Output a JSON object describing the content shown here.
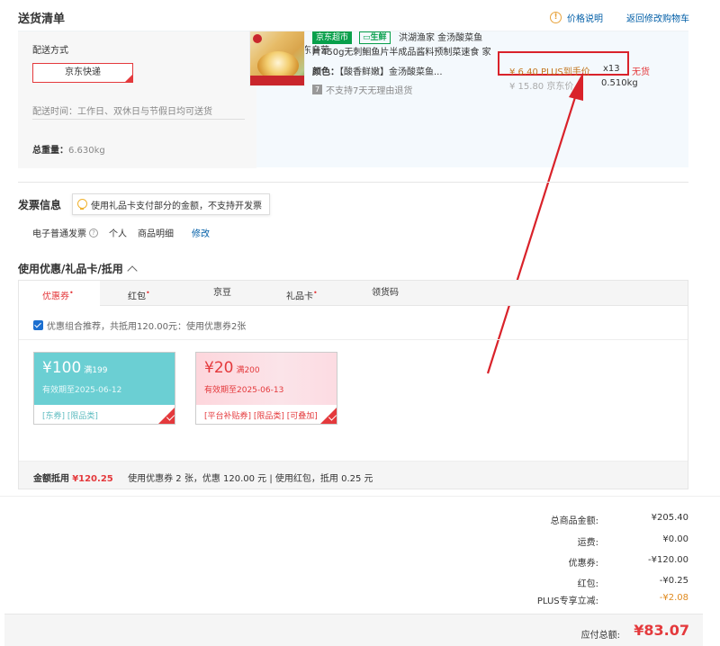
{
  "header": {
    "title": "送货清单",
    "price_note_link": "价格说明",
    "back_to_cart_link": "返回修改购物车"
  },
  "shipping": {
    "method_label": "配送方式",
    "method_selected": "京东快递",
    "delivery_time": "配送时间：工作日、双休日与节假日均可送货",
    "total_weight_label": "总重量：",
    "total_weight_value": "6.630kg"
  },
  "merchant": {
    "label": "商家：京东自营"
  },
  "product": {
    "tag_supermarket": "京东超市",
    "tag_fresh": "生鲜",
    "name_line1": "洪湖渔家 金汤酸菜鱼",
    "name_line2": "片450g无刺鮰鱼片半成品酱料预制菜速食 家",
    "color_label": "颜色：",
    "color_value": "【酸香鲜嫩】金汤酸菜鱼...",
    "no_return": "不支持7天无理由退货",
    "plus_price": "¥ 6.40 PLUS到手价",
    "quantity": "x13",
    "stock_status": "无货",
    "orig_price": "¥ 15.80 京东价",
    "weight": "0.510kg"
  },
  "invoice": {
    "title": "发票信息",
    "tip": "使用礼品卡支付部分的金额，不支持开发票",
    "type": "电子普通发票",
    "personal": "个人",
    "detail": "商品明细",
    "modify": "修改"
  },
  "coupons": {
    "title": "使用优惠/礼品卡/抵用",
    "tabs": [
      {
        "label": "优惠券",
        "dot": "•"
      },
      {
        "label": "红包",
        "dot": "•"
      },
      {
        "label": "京豆",
        "dot": ""
      },
      {
        "label": "礼品卡",
        "dot": "•"
      },
      {
        "label": "领货码",
        "dot": ""
      }
    ],
    "combo_text": "优惠组合推荐，共抵用120.00元：使用优惠券2张",
    "items": [
      {
        "amount": "¥100",
        "threshold": "满199",
        "expiry": "有效期至2025-06-12",
        "tags": "[东券]  [限品类]"
      },
      {
        "amount": "¥20",
        "threshold": "满200",
        "expiry": "有效期至2025-06-13",
        "tags": "[平台补贴券]  [限品类]  [可叠加]"
      }
    ],
    "discount_label": "金额抵用",
    "discount_amount": "¥120.25",
    "discount_detail": "使用优惠券 2 张，优惠 120.00 元  | 使用红包，抵用 0.25 元"
  },
  "summary": {
    "rows": [
      {
        "label": "总商品金额:",
        "value": "¥205.40"
      },
      {
        "label": "运费:",
        "value": "¥0.00"
      },
      {
        "label": "优惠券:",
        "value": "-¥120.00"
      },
      {
        "label": "红包:",
        "value": "-¥0.25"
      },
      {
        "label": "PLUS专享立减:",
        "value": "-¥2.08"
      }
    ],
    "total_label": "应付总额:",
    "total_value": "¥83.07"
  },
  "colors": {
    "accent_red": "#e4393c",
    "annotation_red": "#d9222a",
    "link_blue": "#005ea7",
    "plus_orange": "#c3761f",
    "coupon_teal": "#6bcfd3"
  }
}
